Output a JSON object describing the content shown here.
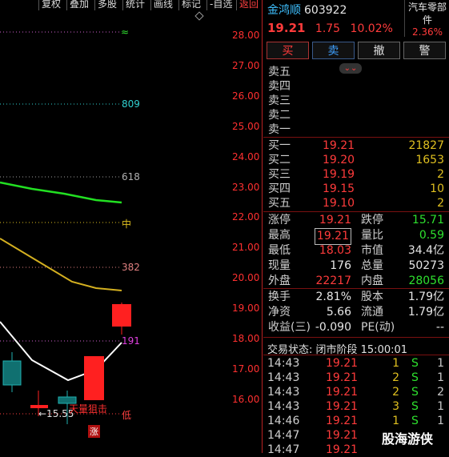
{
  "toolbar": {
    "items": [
      "复权",
      "叠加",
      "多股",
      "统计",
      "画线",
      "标记",
      "-自选",
      "返回"
    ]
  },
  "chart": {
    "y_ticks": [
      "28.00",
      "27.00",
      "26.00",
      "25.00",
      "24.00",
      "23.00",
      "22.00",
      "21.00",
      "20.00",
      "19.00",
      "18.00",
      "17.00",
      "16.00"
    ],
    "fib_labels": [
      "≈",
      "809",
      "618",
      "中",
      "382",
      "191",
      "低"
    ],
    "low_annotation": "←15.55",
    "signal_text": "天量狙击",
    "zhang_badge": "涨",
    "colors": {
      "up": "#ff2020",
      "down": "#20b0b0",
      "ma_green": "#22e022",
      "ma_yellow": "#d4b020",
      "ma_white": "#ffffff"
    }
  },
  "stock": {
    "name": "金鸿顺",
    "code": "603922",
    "price": "19.21",
    "change": "1.75",
    "change_pct": "10.02%"
  },
  "sector": {
    "name": "汽车零部件",
    "pct": "2.36%"
  },
  "buttons": {
    "buy": "买",
    "sell": "卖",
    "cancel": "撤",
    "alert": "警"
  },
  "asks": [
    {
      "label": "卖五",
      "price": "",
      "vol": ""
    },
    {
      "label": "卖四",
      "price": "",
      "vol": ""
    },
    {
      "label": "卖三",
      "price": "",
      "vol": ""
    },
    {
      "label": "卖二",
      "price": "",
      "vol": ""
    },
    {
      "label": "卖一",
      "price": "",
      "vol": ""
    }
  ],
  "bids": [
    {
      "label": "买一",
      "price": "19.21",
      "vol": "21827"
    },
    {
      "label": "买二",
      "price": "19.20",
      "vol": "1653"
    },
    {
      "label": "买三",
      "price": "19.19",
      "vol": "2"
    },
    {
      "label": "买四",
      "price": "19.15",
      "vol": "10"
    },
    {
      "label": "买五",
      "price": "19.10",
      "vol": "2"
    }
  ],
  "stats_left": [
    {
      "k": "涨停",
      "v": "19.21",
      "c": "red"
    },
    {
      "k": "最高",
      "v": "19.21",
      "c": "red"
    },
    {
      "k": "最低",
      "v": "18.03",
      "c": "red"
    },
    {
      "k": "现量",
      "v": "176",
      "c": "white"
    },
    {
      "k": "外盘",
      "v": "22217",
      "c": "red"
    },
    {
      "k": "换手",
      "v": "2.81%",
      "c": "white"
    },
    {
      "k": "净资",
      "v": "5.66",
      "c": "white"
    },
    {
      "k": "收益(三)",
      "v": "-0.090",
      "c": "white"
    }
  ],
  "stats_right": [
    {
      "k": "跌停",
      "v": "15.71",
      "c": "green"
    },
    {
      "k": "量比",
      "v": "0.59",
      "c": "green"
    },
    {
      "k": "市值",
      "v": "34.4亿",
      "c": "white"
    },
    {
      "k": "总量",
      "v": "50273",
      "c": "white"
    },
    {
      "k": "内盘",
      "v": "28056",
      "c": "green"
    },
    {
      "k": "股本",
      "v": "1.79亿",
      "c": "white"
    },
    {
      "k": "流通",
      "v": "1.79亿",
      "c": "white"
    },
    {
      "k": "PE(动)",
      "v": "--",
      "c": "white"
    }
  ],
  "trade_status": "交易状态: 闭市阶段 15:00:01",
  "trades": [
    {
      "t": "14:43",
      "p": "19.21",
      "q": "1",
      "s": "S",
      "n": "1"
    },
    {
      "t": "14:43",
      "p": "19.21",
      "q": "2",
      "s": "S",
      "n": "1"
    },
    {
      "t": "14:43",
      "p": "19.21",
      "q": "2",
      "s": "S",
      "n": "2"
    },
    {
      "t": "14:43",
      "p": "19.21",
      "q": "3",
      "s": "S",
      "n": "1"
    },
    {
      "t": "14:46",
      "p": "19.21",
      "q": "1",
      "s": "S",
      "n": "1"
    },
    {
      "t": "14:47",
      "p": "19.21",
      "q": "",
      "s": "",
      "n": ""
    },
    {
      "t": "14:47",
      "p": "19.21",
      "q": "",
      "s": "",
      "n": ""
    }
  ],
  "watermark": "股海游侠"
}
